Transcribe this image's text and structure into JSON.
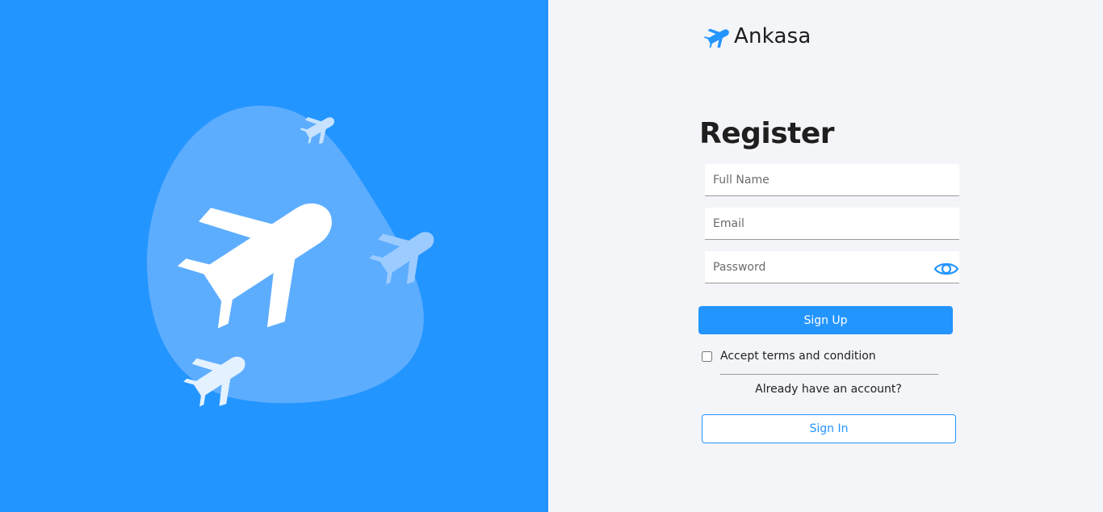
{
  "brand": {
    "name": "Ankasa",
    "logo_icon": "plane-icon"
  },
  "form": {
    "title": "Register",
    "full_name_placeholder": "Full Name",
    "email_placeholder": "Email",
    "password_placeholder": "Password",
    "password_toggle_icon": "eye-icon",
    "signup_label": "Sign Up",
    "terms_label": "Accept terms and condition",
    "terms_checked": false,
    "already_text": "Already have an account?",
    "signin_label": "Sign In"
  },
  "illustration": {
    "main_icon": "plane-icon",
    "small_icons": [
      "small-plane-icon",
      "small-plane-icon",
      "small-plane-icon"
    ]
  },
  "colors": {
    "primary": "#2395ff",
    "panel_bg": "#f4f5f8",
    "blob": "#5dadff",
    "text_dark": "#1f1f1f"
  }
}
